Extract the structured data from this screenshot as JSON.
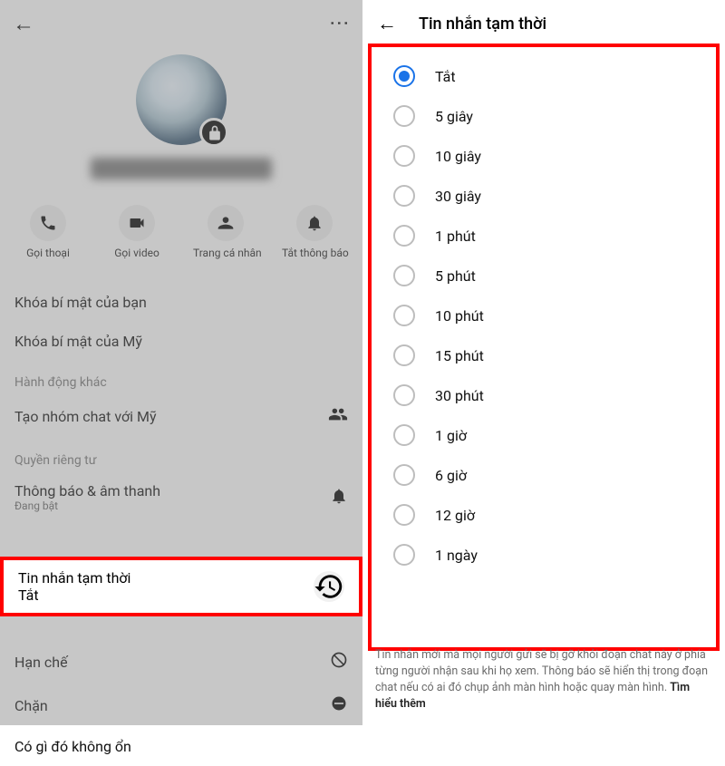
{
  "left": {
    "header": {
      "back": "←",
      "more": "⋮"
    },
    "actions": [
      {
        "id": "call-voice",
        "label": "Gọi thoại"
      },
      {
        "id": "call-video",
        "label": "Gọi video"
      },
      {
        "id": "profile",
        "label": "Trang cá nhân"
      },
      {
        "id": "mute",
        "label": "Tắt thông báo"
      }
    ],
    "rows": {
      "secret_you": "Khóa bí mật của bạn",
      "secret_my": "Khóa bí mật của Mỹ",
      "section_other": "Hành động khác",
      "create_group": "Tạo nhóm chat với Mỹ",
      "section_privacy": "Quyền riêng tư",
      "notif_sound": {
        "label": "Thông báo & âm thanh",
        "sub": "Đang bật"
      },
      "temp_msg": {
        "label": "Tin nhắn tạm thời",
        "sub": "Tắt"
      },
      "restrict": "Hạn chế",
      "block": "Chặn",
      "something_wrong": "Có gì đó không ổn"
    }
  },
  "right": {
    "title": "Tin nhắn tạm thời",
    "selected_index": 0,
    "options": [
      "Tắt",
      "5 giây",
      "10 giây",
      "30 giây",
      "1 phút",
      "5 phút",
      "10 phút",
      "15 phút",
      "30 phút",
      "1 giờ",
      "6 giờ",
      "12 giờ",
      "1 ngày"
    ],
    "footer": "Tin nhắn mới mà mọi người gửi sẽ bị gỡ khỏi đoạn chat này ở phía từng người nhận sau khi họ xem. Thông báo sẽ hiển thị trong đoạn chat nếu có ai đó chụp ảnh màn hình hoặc quay màn hình.",
    "footer_link": "Tìm hiểu thêm"
  }
}
